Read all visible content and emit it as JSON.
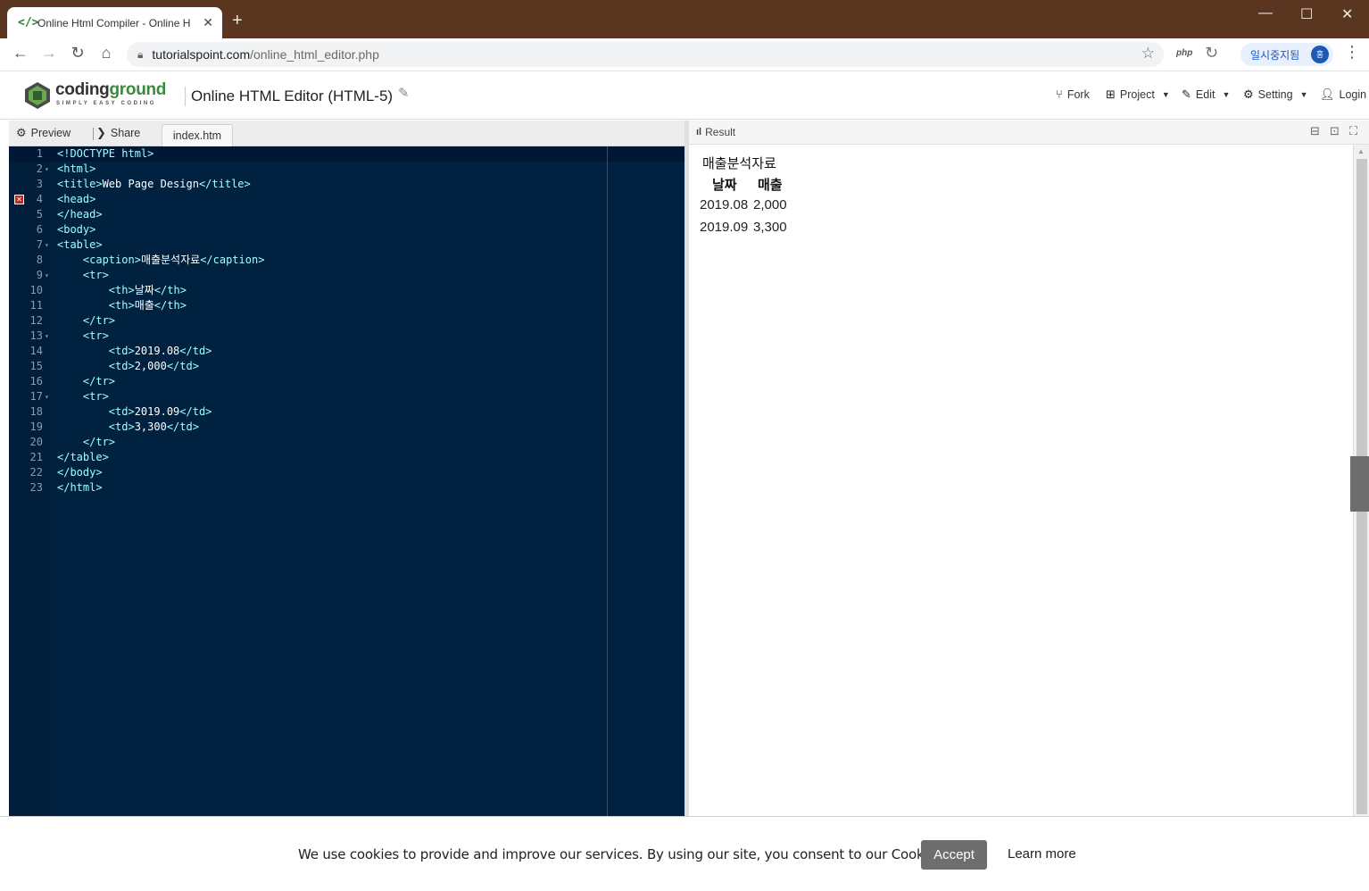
{
  "browser": {
    "tab_title": "Online Html Compiler - Online H",
    "tab_favicon": "</>",
    "url_host": "tutorialspoint.com",
    "url_path": "/online_html_editor.php",
    "profile_status": "일시중지됨",
    "profile_initial": "홍",
    "ext_php": "php"
  },
  "header": {
    "logo_word_1": "coding",
    "logo_word_2": "ground",
    "logo_tagline": "SIMPLY EASY CODING",
    "editor_title": "Online HTML Editor (HTML-5)",
    "nav": {
      "fork": "Fork",
      "project": "Project",
      "edit": "Edit",
      "setting": "Setting",
      "login": "Login"
    }
  },
  "left_tabs": {
    "preview": "Preview",
    "share": "Share",
    "file": "index.htm"
  },
  "editor": {
    "error_line": 4,
    "lines": [
      "<!DOCTYPE html>",
      "<html>",
      "<title>Web Page Design</title>",
      "<head>",
      "</head>",
      "<body>",
      "<table>",
      "    <caption>매출분석자료</caption>",
      "    <tr>",
      "        <th>날짜</th>",
      "        <th>매출</th>",
      "    </tr>",
      "    <tr>",
      "        <td>2019.08</td>",
      "        <td>2,000</td>",
      "    </tr>",
      "    <tr>",
      "        <td>2019.09</td>",
      "        <td>3,300</td>",
      "    </tr>",
      "</table>",
      "</body>",
      "</html>"
    ],
    "fold_lines": [
      2,
      7,
      9,
      13,
      17
    ]
  },
  "result": {
    "title": "Result",
    "caption": "매출분석자료",
    "headers": [
      "날짜",
      "매출"
    ],
    "rows": [
      [
        "2019.08",
        "2,000"
      ],
      [
        "2019.09",
        "3,300"
      ]
    ]
  },
  "cookie": {
    "text": "We use cookies to provide and improve our services. By using our site, you consent to our Cookies Policy.",
    "accept": "Accept",
    "learn_more": "Learn more"
  }
}
